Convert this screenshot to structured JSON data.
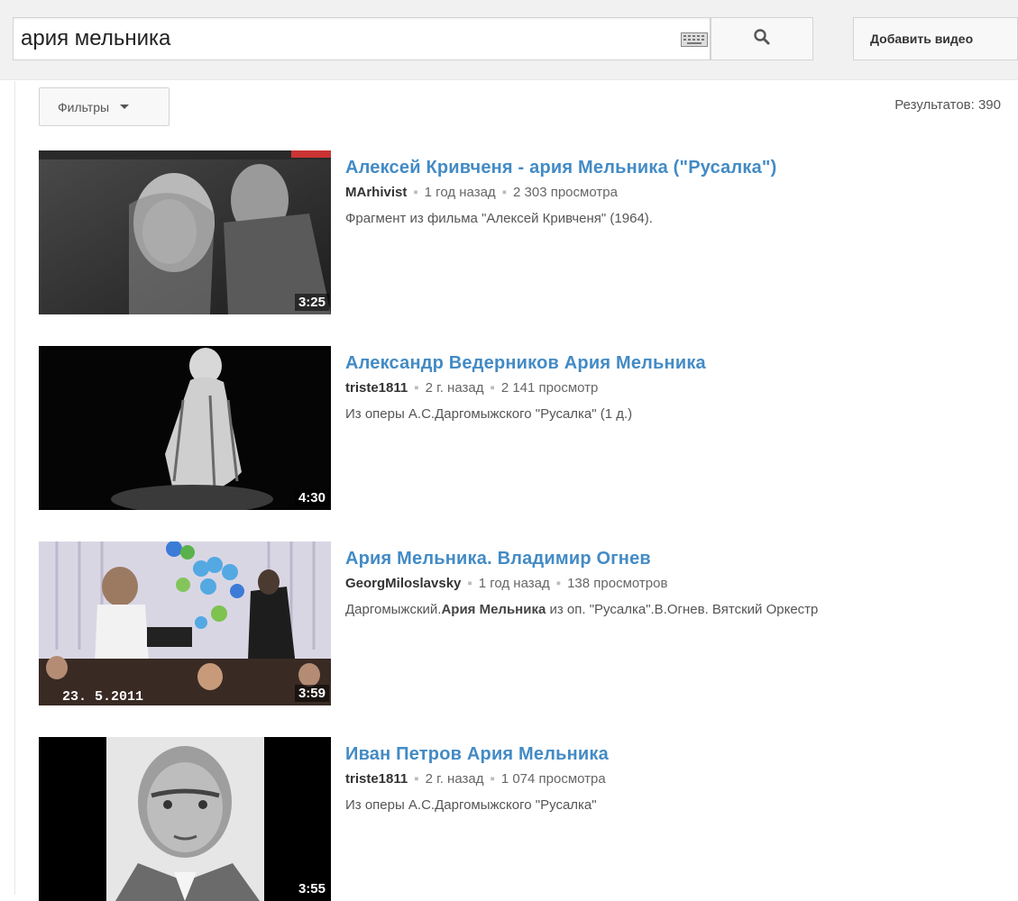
{
  "search": {
    "query": "ария мельника",
    "upload_label": "Добавить видео"
  },
  "filters": {
    "label": "Фильтры",
    "results_count": "Результатов: 390"
  },
  "videos": [
    {
      "title": "Алексей Кривченя - ария Мельника (\"Русалка\")",
      "channel": "MArhivist",
      "age": "1 год назад",
      "views": "2 303 просмотра",
      "desc": "Фрагмент из фильма \"Алексей Кривченя\" (1964).",
      "duration": "3:25"
    },
    {
      "title": "Александр Ведерников Ария Мельника",
      "channel": "triste1811",
      "age": "2 г. назад",
      "views": "2 141 просмотр",
      "desc": "Из оперы А.С.Даргомыжского \"Русалка\" (1 д.)",
      "duration": "4:30"
    },
    {
      "title": "Ария Мельника. Владимир Огнев",
      "channel": "GeorgMiloslavsky",
      "age": "1 год назад",
      "views": "138 просмотров",
      "desc_prefix": "Даргомыжский.",
      "desc_bold": "Ария Мельника",
      "desc_suffix": " из оп. \"Русалка\".В.Огнев. Вятский Оркестр",
      "duration": "3:59",
      "date_overlay": "23. 5.2011"
    },
    {
      "title": "Иван Петров Ария Мельника",
      "channel": "triste1811",
      "age": "2 г. назад",
      "views": "1 074 просмотра",
      "desc": "Из оперы А.С.Даргомыжского \"Русалка\"",
      "duration": "3:55"
    }
  ],
  "separator": "▪",
  "icons": {
    "search": "search-icon",
    "keyboard": "keyboard-icon",
    "caret": "chevron-down-icon"
  },
  "colors": {
    "title_link": "#438bc5",
    "masthead_bg": "#f1f1f1"
  }
}
